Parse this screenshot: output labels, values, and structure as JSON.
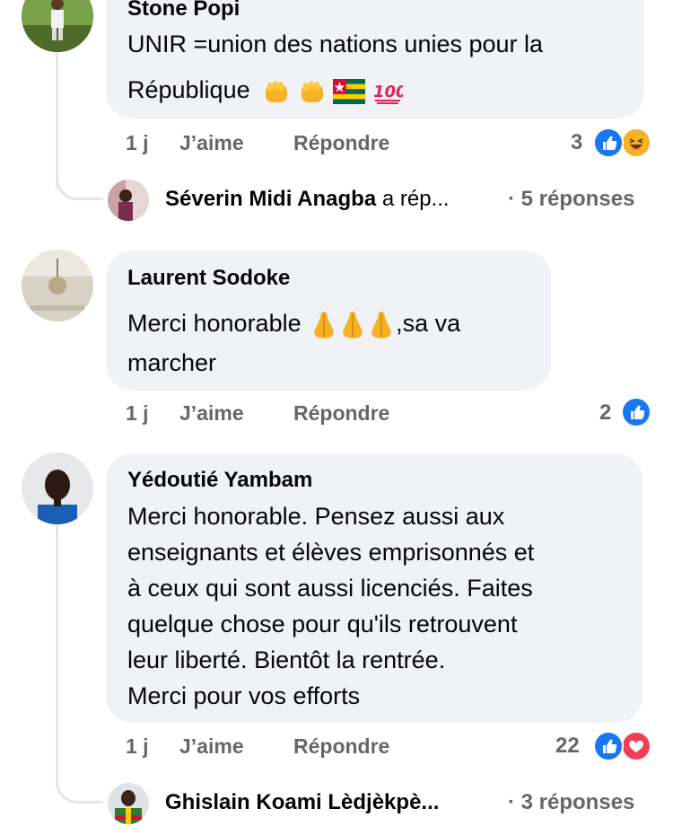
{
  "comments": [
    {
      "author": "Stone Popi",
      "text_line1": "UNIR =union des nations unies pour la",
      "text_line2": "République",
      "time": "1 j",
      "like_label": "J’aime",
      "reply_label": "Répondre",
      "reaction_count": "3",
      "reactions": [
        "like-icon",
        "haha-icon"
      ]
    },
    {
      "author": "Laurent Sodoke",
      "text_line1": "Merci honorable",
      "text_line1_after": ",sa va",
      "text_line2": "marcher",
      "time": "1 j",
      "like_label": "J’aime",
      "reply_label": "Répondre",
      "reaction_count": "2",
      "reactions": [
        "like-icon"
      ]
    },
    {
      "author": "Yédoutié Yambam",
      "lines": [
        "Merci honorable. Pensez aussi aux",
        "enseignants et élèves emprisonnés et",
        "à ceux qui sont aussi licenciés. Faites",
        "quelque chose pour qu'ils retrouvent",
        "leur liberté. Bientôt la rentrée.",
        "Merci pour vos efforts"
      ],
      "time": "1 j",
      "like_label": "J’aime",
      "reply_label": "Répondre",
      "reaction_count": "22",
      "reactions": [
        "like-icon",
        "love-icon"
      ]
    }
  ],
  "replies": [
    {
      "name": "Séverin Midi Anagba",
      "extra": " a rép...",
      "count": "· 5 réponses"
    },
    {
      "name": "Ghislain Koami Lèdjèkpè...",
      "extra": "",
      "count": "· 3 réponses"
    }
  ],
  "colors": {
    "like": "#1877f2",
    "love": "#f33e58",
    "haha": "#f7b125",
    "muted": "#65676b",
    "bubble": "#f0f2f5"
  }
}
